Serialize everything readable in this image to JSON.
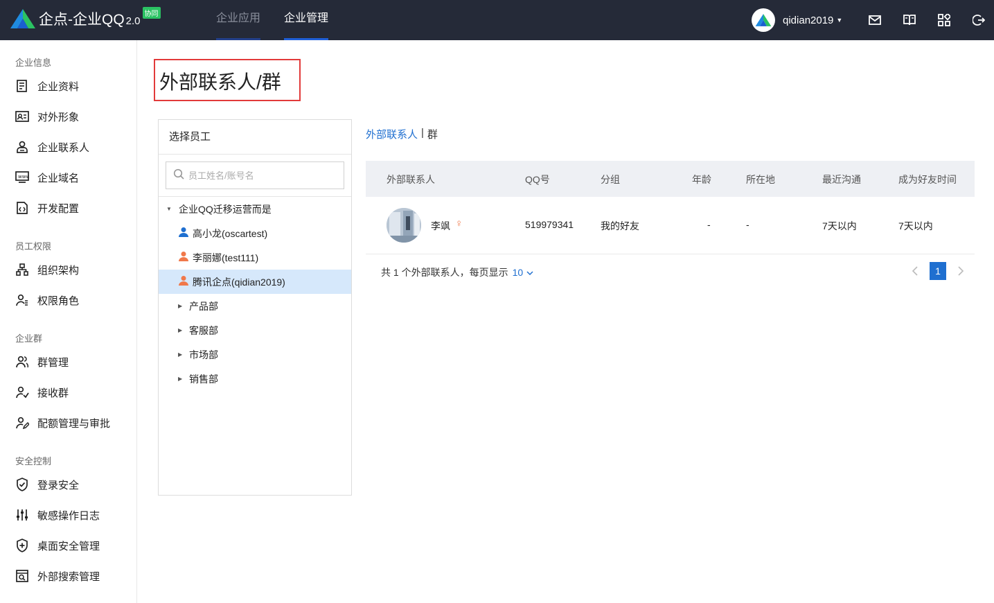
{
  "header": {
    "brand": "企点-企业QQ",
    "version": "2.0",
    "badge": "协同",
    "nav": [
      {
        "label": "企业应用",
        "active": false
      },
      {
        "label": "企业管理",
        "active": true
      }
    ],
    "username": "qidian2019",
    "icons": [
      "mail-icon",
      "book-icon",
      "apps-icon",
      "logout-icon"
    ]
  },
  "sidebar": {
    "groups": [
      {
        "title": "企业信息",
        "items": [
          {
            "label": "企业资料",
            "icon": "document-icon"
          },
          {
            "label": "对外形象",
            "icon": "id-card-icon"
          },
          {
            "label": "企业联系人",
            "icon": "contact-icon"
          },
          {
            "label": "企业域名",
            "icon": "domain-icon"
          },
          {
            "label": "开发配置",
            "icon": "code-icon"
          }
        ]
      },
      {
        "title": "员工权限",
        "items": [
          {
            "label": "组织架构",
            "icon": "org-chart-icon"
          },
          {
            "label": "权限角色",
            "icon": "role-icon"
          }
        ]
      },
      {
        "title": "企业群",
        "items": [
          {
            "label": "群管理",
            "icon": "group-icon"
          },
          {
            "label": "接收群",
            "icon": "receive-group-icon"
          },
          {
            "label": "配额管理与审批",
            "icon": "quota-icon"
          }
        ]
      },
      {
        "title": "安全控制",
        "items": [
          {
            "label": "登录安全",
            "icon": "shield-check-icon"
          },
          {
            "label": "敏感操作日志",
            "icon": "sliders-icon"
          },
          {
            "label": "桌面安全管理",
            "icon": "shield-plus-icon"
          },
          {
            "label": "外部搜索管理",
            "icon": "search-box-icon"
          }
        ]
      }
    ]
  },
  "main": {
    "title": "外部联系人/群",
    "employee_panel": {
      "header": "选择员工",
      "search_placeholder": "员工姓名/账号名",
      "root": "企业QQ迁移运营而是",
      "members": [
        {
          "label": "高小龙(oscartest)",
          "color": "#1f6fd0",
          "selected": false
        },
        {
          "label": "李丽娜(test111)",
          "color": "#f0784a",
          "selected": false
        },
        {
          "label": "腾讯企点(qidian2019)",
          "color": "#f0784a",
          "selected": true
        }
      ],
      "departments": [
        "产品部",
        "客服部",
        "市场部",
        "销售部"
      ]
    },
    "tabs": {
      "active": "外部联系人",
      "separator": "|",
      "other": "群"
    },
    "table": {
      "columns": [
        "外部联系人",
        "QQ号",
        "分组",
        "年龄",
        "所在地",
        "最近沟通",
        "成为好友时间"
      ],
      "rows": [
        {
          "name": "李飒",
          "gender": "♀",
          "qq": "519979341",
          "group": "我的好友",
          "age": "-",
          "location": "-",
          "last_contact": "7天以内",
          "friend_since": "7天以内"
        }
      ]
    },
    "footer": {
      "summary": "共 1  个外部联系人，每页显示",
      "page_size": "10",
      "current_page": "1"
    }
  },
  "colors": {
    "topbar": "#252a38",
    "accent": "#1f6fd0",
    "highlight_border": "#e23a3a",
    "selected_row": "#d6e8fb",
    "badge": "#2bc363"
  }
}
